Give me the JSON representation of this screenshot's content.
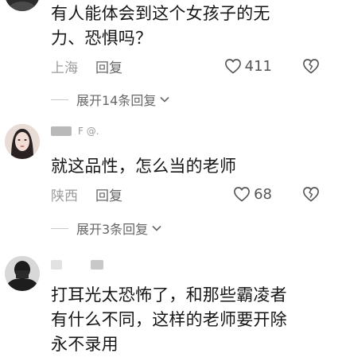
{
  "colors": {
    "text": "#161616",
    "meta": "#8a8a8a",
    "reply": "#666666",
    "icon": "#555555",
    "divider": "#c9c9c9"
  },
  "comments": [
    {
      "text": "有人能体会到这个女孩子的无\n力、恐惧吗？",
      "location": "上海",
      "reply_label": "回复",
      "likes": "411",
      "expand_label": "展开14条回复"
    },
    {
      "username": "F @.",
      "text": "就这品性，怎么当的老师",
      "location": "陕西",
      "reply_label": "回复",
      "likes": "68",
      "expand_label": "展开3条回复"
    },
    {
      "text": "打耳光太恐怖了，和那些霸凌者\n有什么不同，这样的老师要开除\n永不录用"
    }
  ],
  "icons": {
    "like": "heart-outline-icon",
    "dislike": "broken-heart-icon",
    "expand": "chevron-down-icon"
  }
}
